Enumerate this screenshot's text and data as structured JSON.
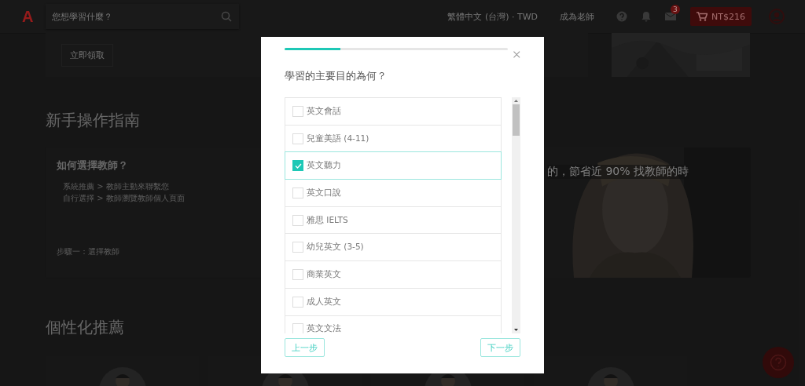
{
  "header": {
    "logo": "A",
    "search": {
      "placeholder": "您想學習什麼？"
    },
    "language": "繁體中文 (台灣) · TWD",
    "become_teacher": "成為老師",
    "messages_badge": "3",
    "cart": "NT$216"
  },
  "promo": {
    "button": "立即領取"
  },
  "guide": {
    "heading": "新手操作指南",
    "card_title": "如何選擇教師？",
    "bullets": [
      "系統推薦 > 教師主動來聯繫您",
      "自行選擇 > 教師瀏覽教師個人頁面"
    ],
    "step": "步驟一：選擇教師",
    "banner_text": "的，節省近 90% 找教師的時"
  },
  "recommend": {
    "heading": "個性化推薦"
  },
  "modal": {
    "progress": {
      "level": 0.25
    },
    "title": "學習的主要目的為何？",
    "options": [
      {
        "label": "英文會話",
        "checked": false
      },
      {
        "label": "兒童美語 (4-11)",
        "checked": false
      },
      {
        "label": "英文聽力",
        "checked": true
      },
      {
        "label": "英文口說",
        "checked": false
      },
      {
        "label": "雅思 IELTS",
        "checked": false
      },
      {
        "label": "幼兒英文 (3-5)",
        "checked": false
      },
      {
        "label": "商業英文",
        "checked": false
      },
      {
        "label": "成人英文",
        "checked": false
      },
      {
        "label": "英文文法",
        "checked": false
      }
    ],
    "back_button": "上一步",
    "next_button": "下一步"
  }
}
